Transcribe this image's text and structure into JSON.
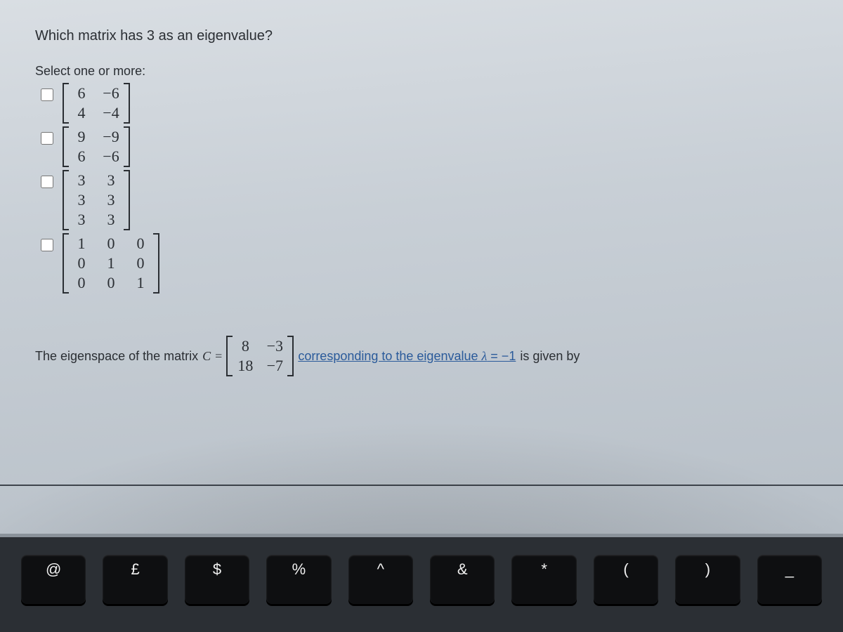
{
  "question1": {
    "prompt": "Which matrix has 3 as an eigenvalue?",
    "instruction": "Select one or more:",
    "options": [
      {
        "matrix": [
          [
            "6",
            "−6"
          ],
          [
            "4",
            "−4"
          ]
        ]
      },
      {
        "matrix": [
          [
            "9",
            "−9"
          ],
          [
            "6",
            "−6"
          ]
        ]
      },
      {
        "matrix": [
          [
            "3",
            "3"
          ],
          [
            "3",
            "3"
          ],
          [
            "3",
            "3"
          ]
        ]
      },
      {
        "matrix": [
          [
            "1",
            "0",
            "0"
          ],
          [
            "0",
            "1",
            "0"
          ],
          [
            "0",
            "0",
            "1"
          ]
        ]
      }
    ]
  },
  "question2": {
    "pre_text": "The eigenspace of the matrix ",
    "matrix_var": "C",
    "equals": " = ",
    "matrix": [
      [
        "8",
        "−3"
      ],
      [
        "18",
        "−7"
      ]
    ],
    "mid_text_link": "corresponding to the eigenvalue ",
    "lambda": "λ",
    "lambda_val": " = −1",
    "post_text": " is given by"
  },
  "keyboard": [
    "@",
    "£",
    "$",
    "%",
    "^",
    "&",
    "*",
    "(",
    ")",
    "_"
  ]
}
